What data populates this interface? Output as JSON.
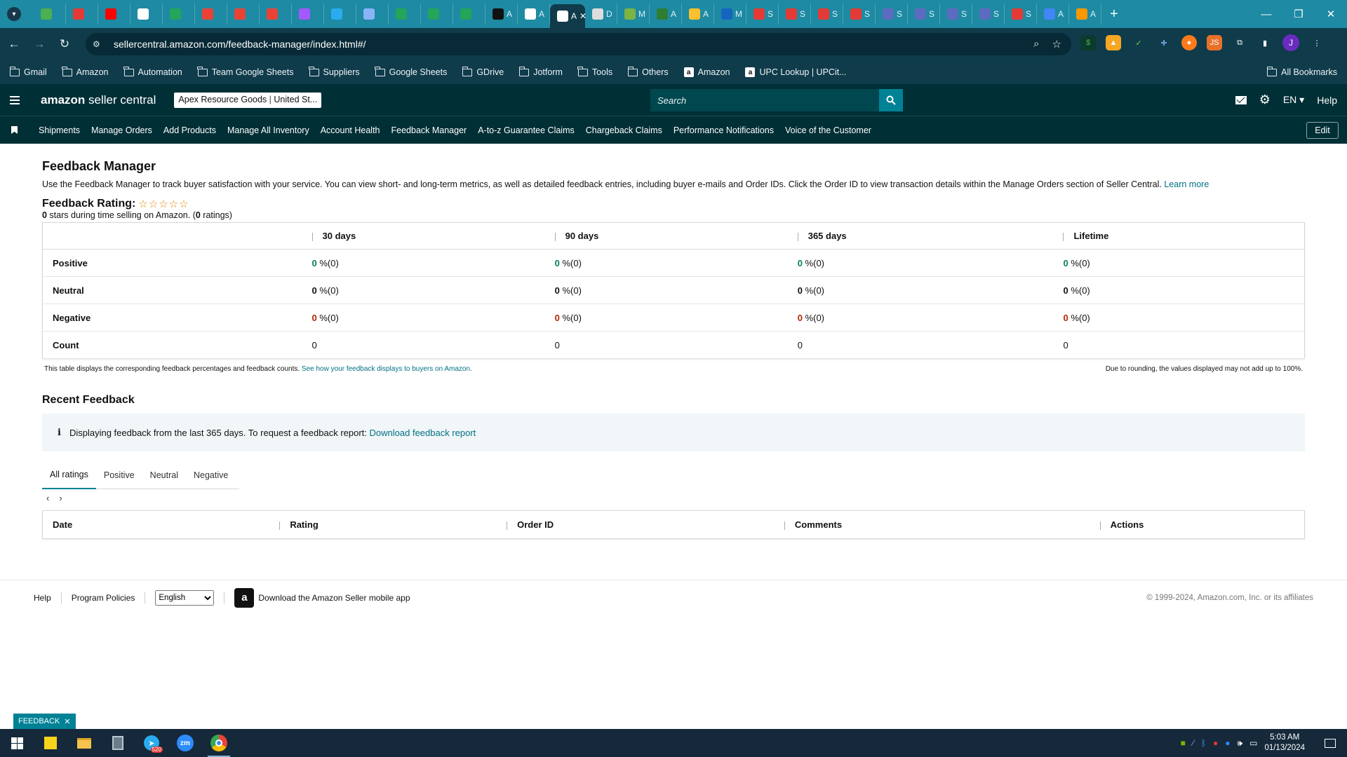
{
  "browser": {
    "tabs": [
      {
        "label": "",
        "color": "#4caf50"
      },
      {
        "label": "",
        "color": "#e53935"
      },
      {
        "label": "",
        "color": "#ff0000"
      },
      {
        "label": "",
        "color": "#ffffff"
      },
      {
        "label": "",
        "color": "#23a55a"
      },
      {
        "label": "",
        "color": "#ea4335"
      },
      {
        "label": "",
        "color": "#ea4335"
      },
      {
        "label": "",
        "color": "#ea4335"
      },
      {
        "label": "",
        "color": "#a259ff"
      },
      {
        "label": "",
        "color": "#2aabee"
      },
      {
        "label": "",
        "color": "#8ab4f8"
      },
      {
        "label": "",
        "color": "#23a55a"
      },
      {
        "label": "",
        "color": "#23a55a"
      },
      {
        "label": "",
        "color": "#23a55a"
      },
      {
        "label": "A",
        "color": "#111111"
      },
      {
        "label": "A",
        "color": "#ffffff"
      },
      {
        "label": "A",
        "color": "#ffffff",
        "active": true
      },
      {
        "label": "D",
        "color": "#dddddd"
      },
      {
        "label": "M",
        "color": "#7cb342"
      },
      {
        "label": "A",
        "color": "#2e7d32"
      },
      {
        "label": "A",
        "color": "#fbc02d"
      },
      {
        "label": "M",
        "color": "#1565c0"
      },
      {
        "label": "S",
        "color": "#e53935"
      },
      {
        "label": "S",
        "color": "#e53935"
      },
      {
        "label": "S",
        "color": "#e53935"
      },
      {
        "label": "S",
        "color": "#e53935"
      },
      {
        "label": "S",
        "color": "#5c6bc0"
      },
      {
        "label": "S",
        "color": "#5c6bc0"
      },
      {
        "label": "S",
        "color": "#5c6bc0"
      },
      {
        "label": "S",
        "color": "#5c6bc0"
      },
      {
        "label": "S",
        "color": "#e53935"
      },
      {
        "label": "A",
        "color": "#4285f4"
      },
      {
        "label": "A",
        "color": "#ff9800"
      }
    ],
    "url": "sellercentral.amazon.com/feedback-manager/index.html#/",
    "bookmarks": [
      {
        "label": "Gmail",
        "type": "folder"
      },
      {
        "label": "Amazon",
        "type": "folder"
      },
      {
        "label": "Automation",
        "type": "folder"
      },
      {
        "label": "Team Google Sheets",
        "type": "folder"
      },
      {
        "label": "Suppliers",
        "type": "folder"
      },
      {
        "label": "Google Sheets",
        "type": "folder"
      },
      {
        "label": "GDrive",
        "type": "folder"
      },
      {
        "label": "Jotform",
        "type": "folder"
      },
      {
        "label": "Tools",
        "type": "folder"
      },
      {
        "label": "Others",
        "type": "folder"
      },
      {
        "label": "Amazon",
        "type": "site"
      },
      {
        "label": "UPC Lookup | UPCit...",
        "type": "site"
      }
    ],
    "all_bookmarks": "All Bookmarks",
    "profile_initial": "J"
  },
  "header": {
    "logo_main": "amazon",
    "logo_sub": " seller central",
    "store_name": "Apex Resource Goods",
    "marketplace": "United St...",
    "search_placeholder": "Search",
    "language": "EN",
    "help": "Help"
  },
  "nav": {
    "items": [
      "Shipments",
      "Manage Orders",
      "Add Products",
      "Manage All Inventory",
      "Account Health",
      "Feedback Manager",
      "A-to-z Guarantee Claims",
      "Chargeback Claims",
      "Performance Notifications",
      "Voice of the Customer"
    ],
    "edit": "Edit"
  },
  "page": {
    "title": "Feedback Manager",
    "description": "Use the Feedback Manager to track buyer satisfaction with your service. You can view short- and long-term metrics, as well as detailed feedback entries, including buyer e-mails and Order IDs. Click the Order ID to view transaction details within the Manage Orders section of Seller Central.",
    "learn_more": "Learn more",
    "rating_label": "Feedback Rating:",
    "stars": 0,
    "stars_max": 5,
    "stars_value": "0",
    "stars_text": " stars during time selling on Amazon. (",
    "ratings_count": "0",
    "ratings_text": " ratings)"
  },
  "summary_table": {
    "columns": [
      "30 days",
      "90 days",
      "365 days",
      "Lifetime"
    ],
    "rows": [
      {
        "label": "Positive",
        "cls": "green",
        "cells": [
          {
            "v": "0",
            "s": " %(0)"
          },
          {
            "v": "0",
            "s": " %(0)"
          },
          {
            "v": "0",
            "s": " %(0)"
          },
          {
            "v": "0",
            "s": " %(0)"
          }
        ]
      },
      {
        "label": "Neutral",
        "cls": "blk",
        "cells": [
          {
            "v": "0",
            "s": " %(0)"
          },
          {
            "v": "0",
            "s": " %(0)"
          },
          {
            "v": "0",
            "s": " %(0)"
          },
          {
            "v": "0",
            "s": " %(0)"
          }
        ]
      },
      {
        "label": "Negative",
        "cls": "red",
        "cells": [
          {
            "v": "0",
            "s": " %(0)"
          },
          {
            "v": "0",
            "s": " %(0)"
          },
          {
            "v": "0",
            "s": " %(0)"
          },
          {
            "v": "0",
            "s": " %(0)"
          }
        ]
      },
      {
        "label": "Count",
        "cls": "",
        "cells": [
          {
            "v": "",
            "s": "0"
          },
          {
            "v": "",
            "s": "0"
          },
          {
            "v": "",
            "s": "0"
          },
          {
            "v": "",
            "s": "0"
          }
        ]
      }
    ],
    "note_left": "This table displays the corresponding feedback percentages and feedback counts.",
    "note_link": "See how your feedback displays to buyers on Amazon.",
    "note_right": "Due to rounding, the values displayed may not add up to 100%."
  },
  "recent": {
    "title": "Recent Feedback",
    "info_text": "Displaying feedback from the last 365 days. To request a feedback report:",
    "info_link": "Download feedback report",
    "tabs": [
      "All ratings",
      "Positive",
      "Neutral",
      "Negative"
    ],
    "active_tab": 0,
    "columns": [
      "Date",
      "Rating",
      "Order ID",
      "Comments",
      "Actions"
    ]
  },
  "footer": {
    "help": "Help",
    "policies": "Program Policies",
    "language": "English",
    "app": "Download the Amazon Seller mobile app",
    "copyright": "© 1999-2024, Amazon.com, Inc. or its affiliates"
  },
  "feedback_tag": "FEEDBACK",
  "taskbar": {
    "telegram_badge": "520",
    "time": "5:03 AM",
    "date": "01/13/2024"
  }
}
